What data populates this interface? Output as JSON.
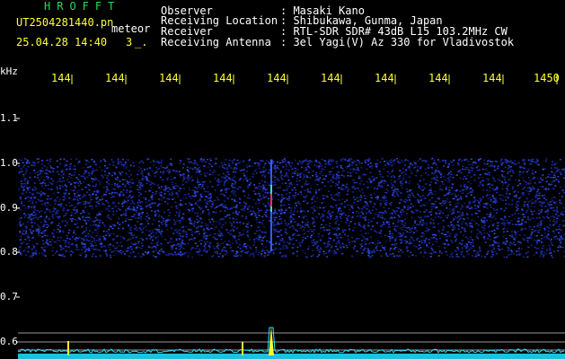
{
  "header": {
    "app_title": "HROFFT",
    "filename": "UT2504281440.pn",
    "mode": "meteor",
    "datetime": "25.04.28 14:40",
    "index": "3",
    "index_suffix": "_.",
    "fields": [
      {
        "label": "Observer",
        "value": ": Masaki Kano"
      },
      {
        "label": "Receiving Location",
        "value": ": Shibukawa, Gunma, Japan"
      },
      {
        "label": "Receiver",
        "value": ": RTL-SDR SDR# 43dB L15 103.2MHz CW"
      },
      {
        "label": "Receiving Antenna",
        "value": ": 3el Yagi(V) Az 330 for Vladivostok"
      }
    ]
  },
  "axes": {
    "y_unit": "kHz",
    "y_ticks": [
      "1.1",
      "1.0",
      "0.9",
      "0.8",
      "0.7",
      "0.6"
    ],
    "x_ticks": [
      "144",
      "144",
      "144",
      "144",
      "144",
      "144",
      "144",
      "144",
      "144",
      "1450"
    ]
  },
  "colors": {
    "text": "#ffffff",
    "time_labels": "#ffff33",
    "title": "#22dd55",
    "noise": "#2233cc",
    "spectrum": "#22e5ff",
    "grid_lines": "#888888"
  }
}
